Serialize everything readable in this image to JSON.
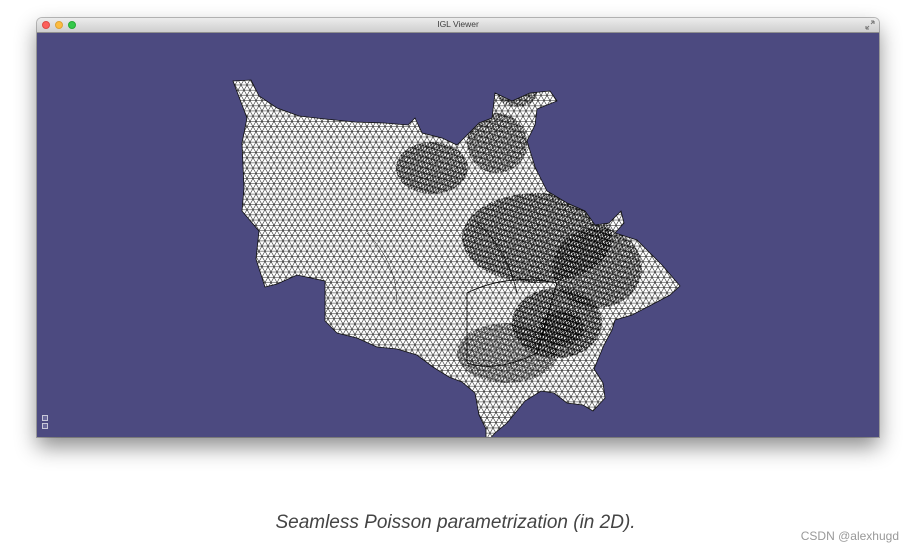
{
  "window": {
    "title": "IGL Viewer"
  },
  "viewport": {
    "background_color": "#4c4a80",
    "mesh_fill_color": "#ffffff",
    "mesh_edge_color": "#000000"
  },
  "icons": {
    "close": "close-icon",
    "minimize": "minimize-icon",
    "maximize": "maximize-icon",
    "fullscreen": "fullscreen-icon"
  },
  "caption": "Seamless Poisson parametrization (in 2D).",
  "watermark": "CSDN @alexhugd"
}
